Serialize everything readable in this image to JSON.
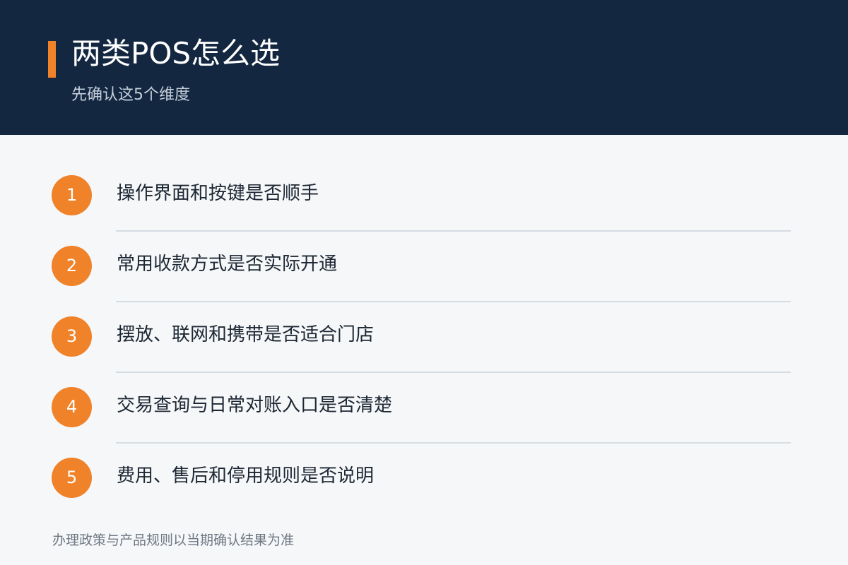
{
  "header": {
    "title": "两类POS怎么选",
    "subtitle": "先确认这5个维度"
  },
  "items": [
    {
      "number": "1",
      "label": "操作界面和按键是否顺手"
    },
    {
      "number": "2",
      "label": "常用收款方式是否实际开通"
    },
    {
      "number": "3",
      "label": "摆放、联网和携带是否适合门店"
    },
    {
      "number": "4",
      "label": "交易查询与日常对账入口是否清楚"
    },
    {
      "number": "5",
      "label": "费用、售后和停用规则是否说明"
    }
  ],
  "footer": {
    "note": "办理政策与产品规则以当期确认结果为准"
  },
  "colors": {
    "header_bg": "#132741",
    "accent": "#f0822a",
    "page_bg": "#f5f7f9"
  }
}
